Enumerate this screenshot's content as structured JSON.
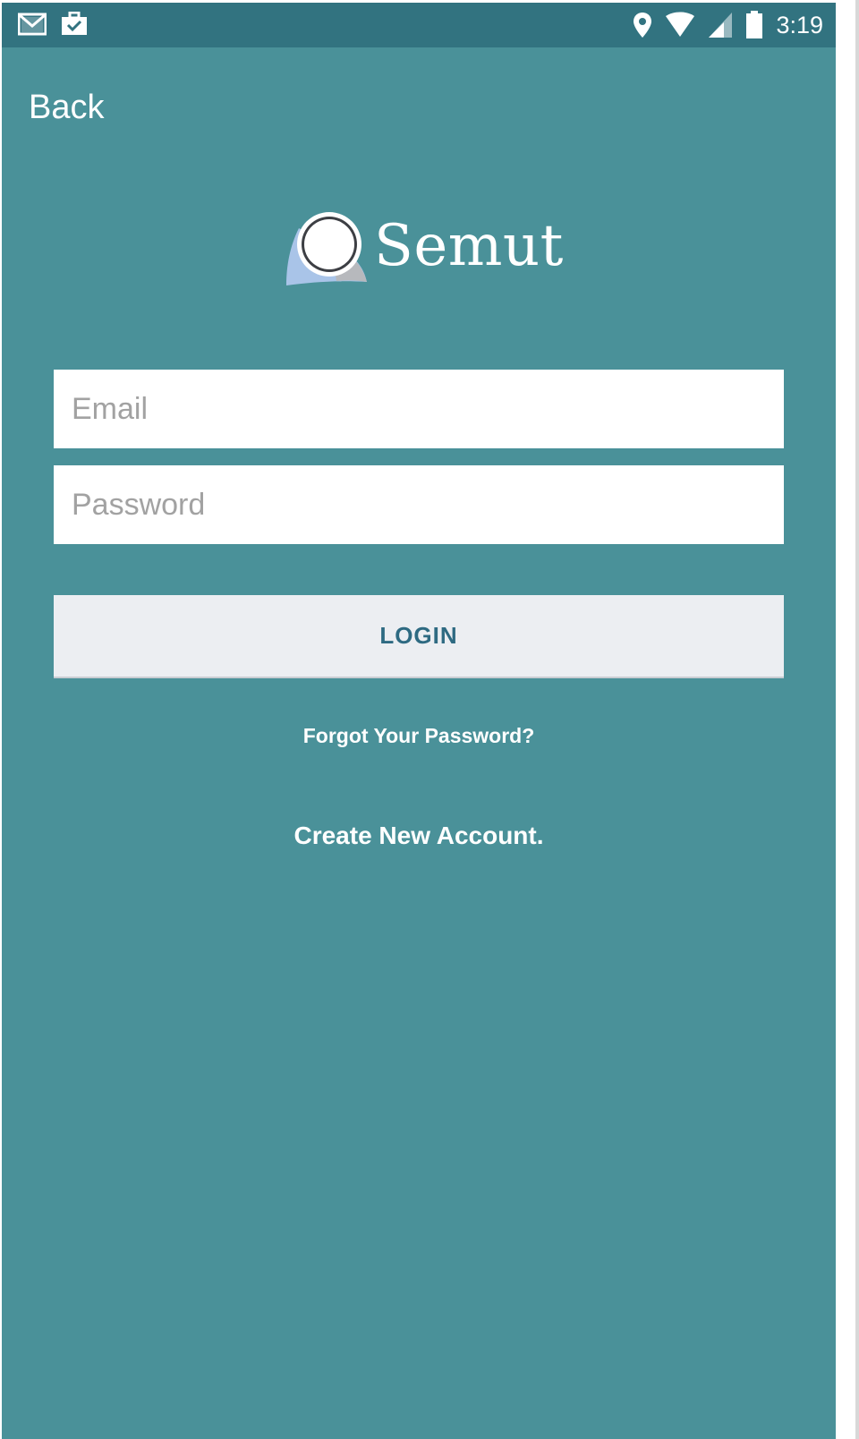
{
  "status_bar": {
    "time": "3:19",
    "left_icons": [
      "gmail-icon",
      "briefcase-check-icon"
    ],
    "right_icons": [
      "location-icon",
      "wifi-icon",
      "signal-icon",
      "battery-icon"
    ]
  },
  "nav": {
    "back_label": "Back"
  },
  "logo": {
    "text": "Semut",
    "icon": "semut-logo-icon"
  },
  "form": {
    "email_placeholder": "Email",
    "email_value": "",
    "password_placeholder": "Password",
    "password_value": "",
    "login_label": "LOGIN"
  },
  "links": {
    "forgot_password": "Forgot Your Password?",
    "create_account": "Create New Account."
  },
  "colors": {
    "background": "#4a9199",
    "status_bar": "#327380",
    "button_bg": "#eceef2",
    "button_text": "#2e6a82"
  }
}
